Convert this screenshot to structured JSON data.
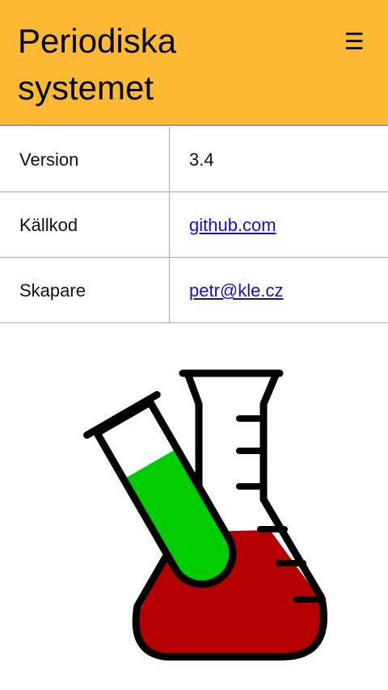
{
  "header": {
    "title": "Periodiska systemet",
    "menu_icon": "hamburger-menu-icon",
    "background_color": "#FDB934"
  },
  "info": {
    "rows": [
      {
        "label": "Version",
        "value": "3.4",
        "is_link": false
      },
      {
        "label": "Källkod",
        "value": "github.com",
        "is_link": true
      },
      {
        "label": "Skapare",
        "value": "petr@kle.cz",
        "is_link": true
      }
    ]
  },
  "illustration": {
    "icon": "chemistry-flask-and-test-tube-icon",
    "flask_liquid_color": "#B40000",
    "tube_liquid_color": "#00CC00",
    "outline_color": "#000000"
  }
}
